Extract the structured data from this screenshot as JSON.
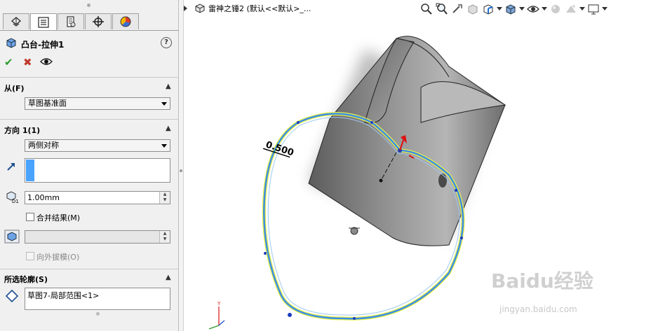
{
  "tabs": [
    {
      "name": "feature-manager",
      "icon": "feature-tree-icon"
    },
    {
      "name": "property-manager",
      "icon": "property-manager-icon"
    },
    {
      "name": "configuration-manager",
      "icon": "configuration-icon"
    },
    {
      "name": "dimxpert-manager",
      "icon": "crosshair-icon"
    },
    {
      "name": "display-manager",
      "icon": "appearance-icon"
    }
  ],
  "feature": {
    "title": "凸台-拉伸1",
    "help_icon": "?"
  },
  "actions": {
    "ok_icon": "✔",
    "cancel_icon": "✖"
  },
  "from": {
    "title": "从(F)",
    "value": "草图基准面"
  },
  "direction": {
    "title": "方向 1(1)",
    "end_condition": "两侧对称",
    "depth": "1.00mm",
    "merge_label": "合并结果(M)",
    "draft_label": "向外拔模(O)"
  },
  "contours": {
    "title": "所选轮廓(S)",
    "value": "草图7-局部范围<1>"
  },
  "tree": {
    "label": "雷神之锤2  (默认<<默认>_..."
  },
  "dimension": {
    "value": "0.500"
  },
  "watermark": {
    "logo": "Baidu经验",
    "url": "jingyan.baidu.com"
  },
  "colors": {
    "accent": "#4aa3ff",
    "ok": "#2d9b2d",
    "cancel": "#c0392b",
    "model": "#8a8a8a",
    "sketch": "#3a8ee6",
    "highlight": "#e8f04a"
  }
}
